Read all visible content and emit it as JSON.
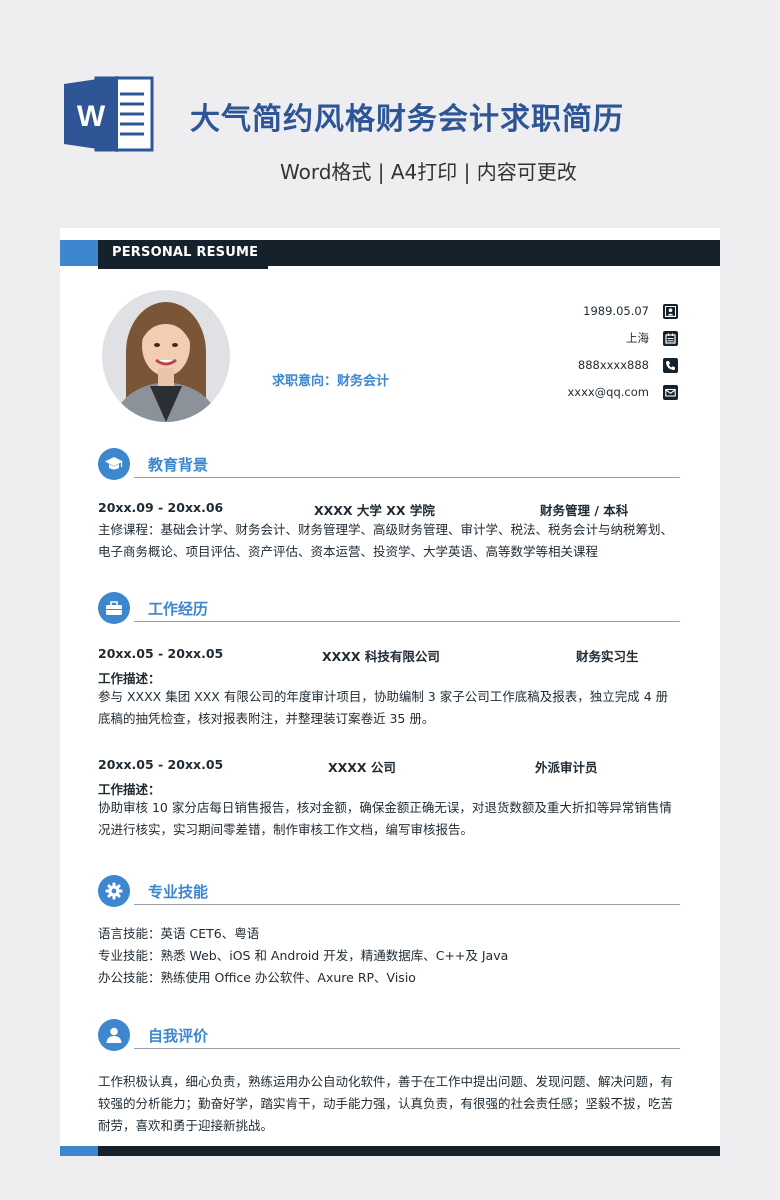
{
  "banner": {
    "title": "大气简约风格财务会计求职简历",
    "subtitle": "Word格式 | A4打印 | 内容可更改",
    "logo_letter": "W"
  },
  "resume": {
    "header_label": "PERSONAL RESUME",
    "intent_label": "求职意向：",
    "intent_value": "财务会计",
    "contacts": [
      {
        "text": "1989.05.07",
        "icon": "person-icon"
      },
      {
        "text": "上海",
        "icon": "calendar-icon"
      },
      {
        "text": "888xxxx888",
        "icon": "phone-icon"
      },
      {
        "text": "xxxx@qq.com",
        "icon": "mail-icon"
      }
    ]
  },
  "education": {
    "title": "教育背景",
    "period": "20xx.09 - 20xx.06",
    "school": "XXXX 大学 XX 学院",
    "major": "财务管理 / 本科",
    "courses": "主修课程：基础会计学、财务会计、财务管理学、高级财务管理、审计学、税法、税务会计与纳税筹划、电子商务概论、项目评估、资产评估、资本运营、投资学、大学英语、高等数学等相关课程"
  },
  "work": {
    "title": "工作经历",
    "jobs": [
      {
        "period": "20xx.05 - 20xx.05",
        "company": "XXXX 科技有限公司",
        "position": "财务实习生",
        "desc_label": "工作描述：",
        "desc": "参与 XXXX 集团 XXX 有限公司的年度审计项目，协助编制 3 家子公司工作底稿及报表，独立完成 4 册底稿的抽凭检查，核对报表附注，并整理装订案卷近 35 册。"
      },
      {
        "period": "20xx.05 - 20xx.05",
        "company": "XXXX 公司",
        "position": "外派审计员",
        "desc_label": "工作描述：",
        "desc": "协助审核 10 家分店每日销售报告，核对金额，确保金额正确无误，对退货数额及重大折扣等异常销售情况进行核实，实习期间零差错，制作审核工作文档，编写审核报告。"
      }
    ]
  },
  "skills": {
    "title": "专业技能",
    "items": [
      "语言技能：英语 CET6、粤语",
      "专业技能：熟悉 Web、iOS 和 Android 开发，精通数据库、C++及 Java",
      "办公技能：熟练使用 Office 办公软件、Axure RP、Visio"
    ]
  },
  "self": {
    "title": "自我评价",
    "text": "工作积极认真，细心负责，熟练运用办公自动化软件，善于在工作中提出问题、发现问题、解决问题，有较强的分析能力；勤奋好学，踏实肯干，动手能力强，认真负责，有很强的社会责任感；坚毅不拔，吃苦耐劳，喜欢和勇于迎接新挑战。"
  },
  "colors": {
    "accent": "#3d87cf",
    "dark": "#15222c",
    "title": "#2e5596"
  }
}
